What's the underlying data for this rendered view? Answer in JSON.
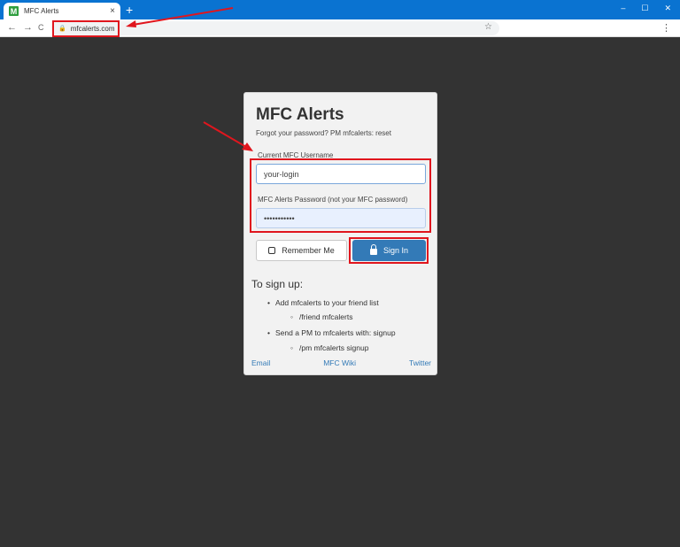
{
  "browser": {
    "tab_title": "MFC Alerts",
    "favicon_letter": "M",
    "new_tab": "+",
    "close": "×",
    "window_controls": [
      "–",
      "☐",
      "✕"
    ],
    "nav": {
      "back": "←",
      "forward": "→",
      "reload": "C"
    },
    "url": "mfcalerts.com",
    "lock_glyph": "🔒",
    "star": "☆",
    "menu": "⋮"
  },
  "login": {
    "title": "MFC Alerts",
    "subtitle": "Forgot your password? PM mfcalerts: reset",
    "username_label": "Current MFC Username",
    "username_value": "your-login",
    "password_label": "MFC Alerts Password (not your MFC password)",
    "password_value": "•••••••••••",
    "remember_label": "Remember Me",
    "signin_label": "Sign In"
  },
  "signup": {
    "title": "To sign up:",
    "step1": "Add mfcalerts to your friend list",
    "step1_cmd": "/friend mfcalerts",
    "step2": "Send a PM to mfcalerts with: signup",
    "step2_cmd": "/pm mfcalerts signup",
    "bullet": "•",
    "sub_bullet": "◦"
  },
  "footer_links": {
    "email": "Email",
    "wiki": "MFC Wiki",
    "twitter": "Twitter"
  },
  "annotation_color": "#e0161e"
}
